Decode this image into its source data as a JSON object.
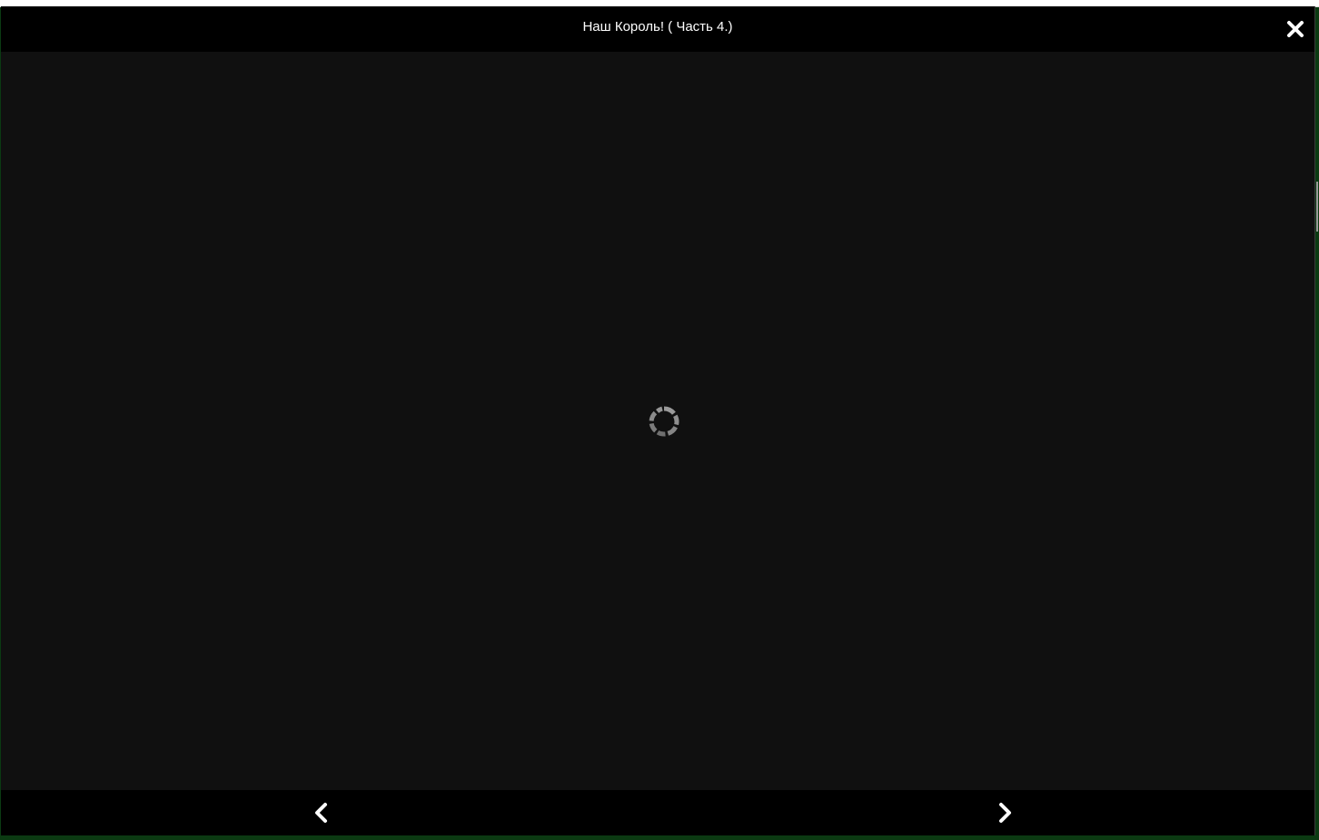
{
  "modal": {
    "title": "Наш Король! ( Часть 4.)",
    "close_icon": "close-icon",
    "loading_icon": "loading-spinner-icon",
    "prev_icon": "chevron-left-icon",
    "next_icon": "chevron-right-icon"
  },
  "colors": {
    "header_background": "#000000",
    "viewer_background": "#101010",
    "title_text": "#ffffff",
    "icon": "#ffffff",
    "spinner": "#8a8a8a"
  }
}
